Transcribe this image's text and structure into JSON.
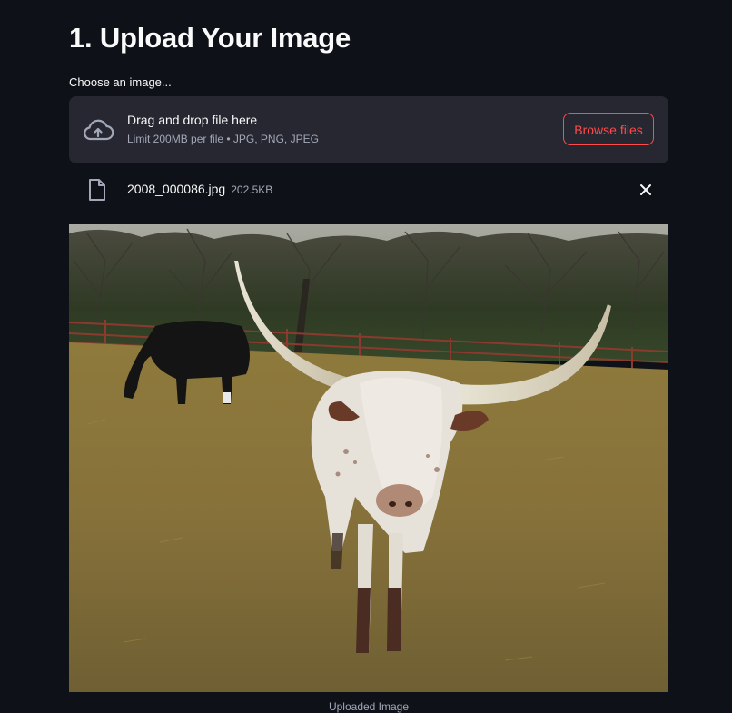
{
  "section": {
    "title": "1. Upload Your Image"
  },
  "uploader": {
    "label": "Choose an image...",
    "dropzone_primary": "Drag and drop file here",
    "dropzone_secondary": "Limit 200MB per file • JPG, PNG, JPEG",
    "browse_label": "Browse files",
    "upload_icon": "cloud-upload-icon"
  },
  "uploaded_file": {
    "name": "2008_000086.jpg",
    "size": "202.5KB",
    "file_icon": "file-icon",
    "remove_icon": "close-icon"
  },
  "image": {
    "caption": "Uploaded Image",
    "description_icon": "photo-longhorn-cattle"
  },
  "colors": {
    "background": "#0e1117",
    "surface": "#262730",
    "accent": "#ff4b4b",
    "text": "#fafafa",
    "muted": "#a3a8b8"
  }
}
